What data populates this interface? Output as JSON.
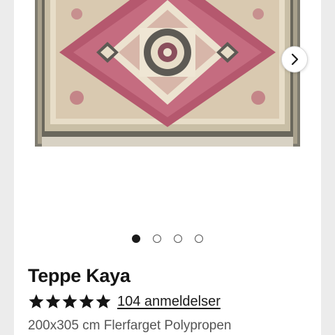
{
  "product": {
    "title": "Teppe Kaya",
    "rating_stars": 5,
    "reviews_label": "104 anmeldelser",
    "spec_line": "200x305 cm Flerfarget Polypropen"
  },
  "carousel": {
    "image": "rug-product-image",
    "slide_count": 4,
    "active_slide": 1,
    "next_icon": "chevron-right-icon"
  },
  "colors": {
    "star": "#141414",
    "rug_red": "#b5586e",
    "rug_cream": "#ece2cf",
    "rug_dark": "#5d5a54"
  }
}
